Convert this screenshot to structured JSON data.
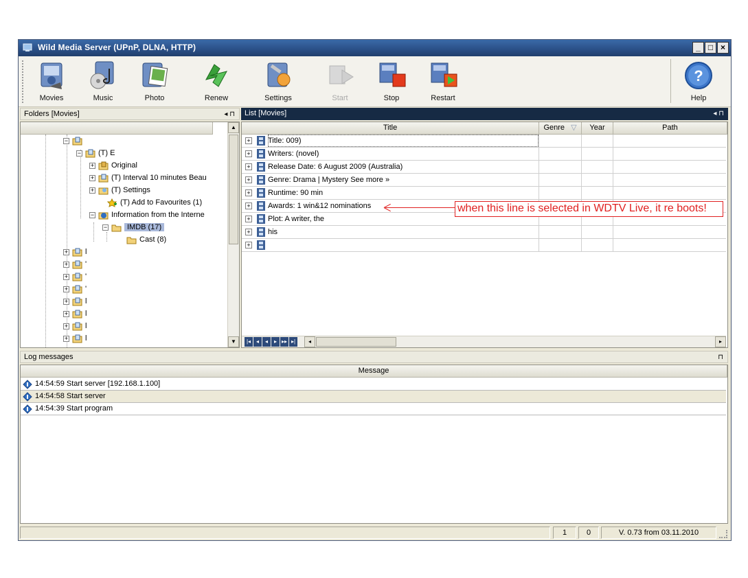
{
  "window": {
    "title": "Wild Media Server (UPnP, DLNA, HTTP)",
    "min_label": "_",
    "max_label": "□",
    "close_label": "×"
  },
  "toolbar": {
    "buttons": [
      {
        "label": "Movies",
        "icon": "movies-icon"
      },
      {
        "label": "Music",
        "icon": "music-icon"
      },
      {
        "label": "Photo",
        "icon": "photo-icon"
      },
      {
        "label": "Renew",
        "icon": "renew-icon"
      },
      {
        "label": "Settings",
        "icon": "settings-icon"
      },
      {
        "label": "Start",
        "icon": "start-icon",
        "disabled": true
      },
      {
        "label": "Stop",
        "icon": "stop-icon"
      },
      {
        "label": "Restart",
        "icon": "restart-icon"
      },
      {
        "label": "Help",
        "icon": "help-icon"
      }
    ]
  },
  "folders": {
    "header": "Folders [Movies]",
    "controls": "◂ ⊓",
    "tree": [
      {
        "label": "",
        "expand": "−"
      },
      {
        "label": "(T) E",
        "expand": "−"
      },
      {
        "label": "Original",
        "expand": "+"
      },
      {
        "label": "(T) Interval 10 minutes Beau",
        "expand": "+"
      },
      {
        "label": "(T) Settings",
        "expand": "+"
      },
      {
        "label": "(T) Add to Favourites (1)",
        "expand": ""
      },
      {
        "label": "Information from the Interne",
        "expand": "−"
      },
      {
        "label": "IMDB (17)",
        "expand": "−",
        "selected": true
      },
      {
        "label": "Cast (8)",
        "expand": ""
      },
      {
        "label": "l",
        "expand": "+"
      },
      {
        "label": "'",
        "expand": "+"
      },
      {
        "label": "'",
        "expand": "+"
      },
      {
        "label": "'",
        "expand": "+"
      },
      {
        "label": "l",
        "expand": "+"
      },
      {
        "label": "l",
        "expand": "+"
      },
      {
        "label": "l",
        "expand": "+"
      },
      {
        "label": "l",
        "expand": "+"
      }
    ]
  },
  "list": {
    "header": "List [Movies]",
    "controls": "◂ ⊓",
    "columns": {
      "title": "Title",
      "genre": "Genre",
      "sort_icon": "▽",
      "year": "Year",
      "path": "Path"
    },
    "rows": [
      {
        "text": "Title:                        009)"
      },
      {
        "text": "Writers:                                                                          (novel)"
      },
      {
        "text": "Release Date: 6 August 2009 (Australia)"
      },
      {
        "text": "Genre: Drama | Mystery See more »"
      },
      {
        "text": "Runtime: 90 min"
      },
      {
        "text": "Awards: 1 win&12 nominations"
      },
      {
        "text": "Plot: A writer,                                                   the"
      },
      {
        "text": "                                                                         his"
      },
      {
        "text": ""
      }
    ],
    "annotation": "when this line is selected in WDTV Live, it re boots!"
  },
  "log": {
    "header": "Log messages",
    "controls": "⊓",
    "column": "Message",
    "rows": [
      {
        "text": "14:54:59 Start server [192.168.1.100]"
      },
      {
        "text": "14:54:58 Start server"
      },
      {
        "text": "14:54:39 Start program"
      }
    ]
  },
  "status": {
    "count1": "1",
    "count2": "0",
    "version": "V. 0.73 from 03.11.2010"
  }
}
